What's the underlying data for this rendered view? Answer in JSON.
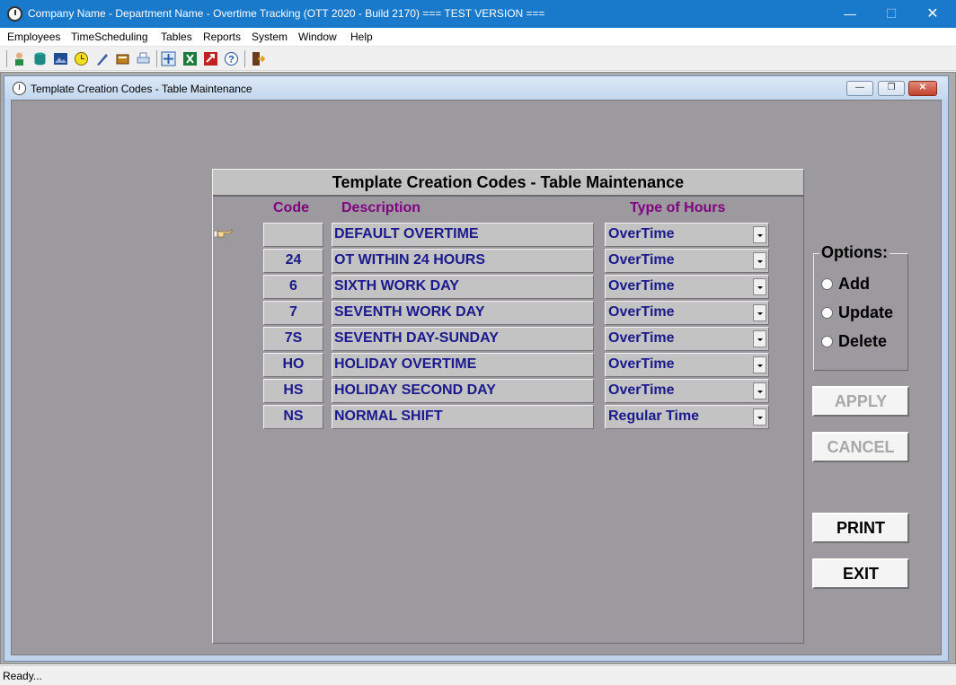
{
  "window": {
    "title": "Company Name - Department Name - Overtime Tracking (OTT 2020 - Build 2170)  === TEST VERSION ===",
    "minimize": "—",
    "maximize": "☐",
    "close": "✕"
  },
  "menu": [
    "Employees",
    "TimeScheduling",
    "Tables",
    "Reports",
    "System",
    "Window",
    "Help"
  ],
  "toolbar_icons": [
    "employee-icon",
    "database-icon",
    "picture-icon",
    "clock-icon",
    "pen-icon",
    "book-icon",
    "printer-icon",
    "sync-icon",
    "excel-icon",
    "export-icon",
    "help-icon",
    "exit-door-icon"
  ],
  "child_window": {
    "title": "Template Creation Codes - Table Maintenance",
    "buttons": {
      "minimize": "—",
      "restore": "❐",
      "close": "✕"
    }
  },
  "panel": {
    "header": "Template Creation Codes - Table Maintenance",
    "columns": {
      "code": "Code",
      "description": "Description",
      "type": "Type of Hours"
    },
    "rows": [
      {
        "code": "",
        "description": "DEFAULT OVERTIME",
        "type": "OverTime"
      },
      {
        "code": "24",
        "description": "OT WITHIN 24 HOURS",
        "type": "OverTime"
      },
      {
        "code": "6",
        "description": "SIXTH WORK DAY",
        "type": "OverTime"
      },
      {
        "code": "7",
        "description": "SEVENTH WORK DAY",
        "type": "OverTime"
      },
      {
        "code": "7S",
        "description": "SEVENTH DAY-SUNDAY",
        "type": "OverTime"
      },
      {
        "code": "HO",
        "description": "HOLIDAY OVERTIME",
        "type": "OverTime"
      },
      {
        "code": "HS",
        "description": "HOLIDAY SECOND DAY",
        "type": "OverTime"
      },
      {
        "code": "NS",
        "description": "NORMAL SHIFT",
        "type": "Regular Time"
      }
    ]
  },
  "options": {
    "label": "Options:",
    "add": "Add",
    "update": "Update",
    "delete": "Delete"
  },
  "buttons": {
    "apply": "APPLY",
    "cancel": "CANCEL",
    "print": "PRINT",
    "exit": "EXIT"
  },
  "status": "Ready..."
}
